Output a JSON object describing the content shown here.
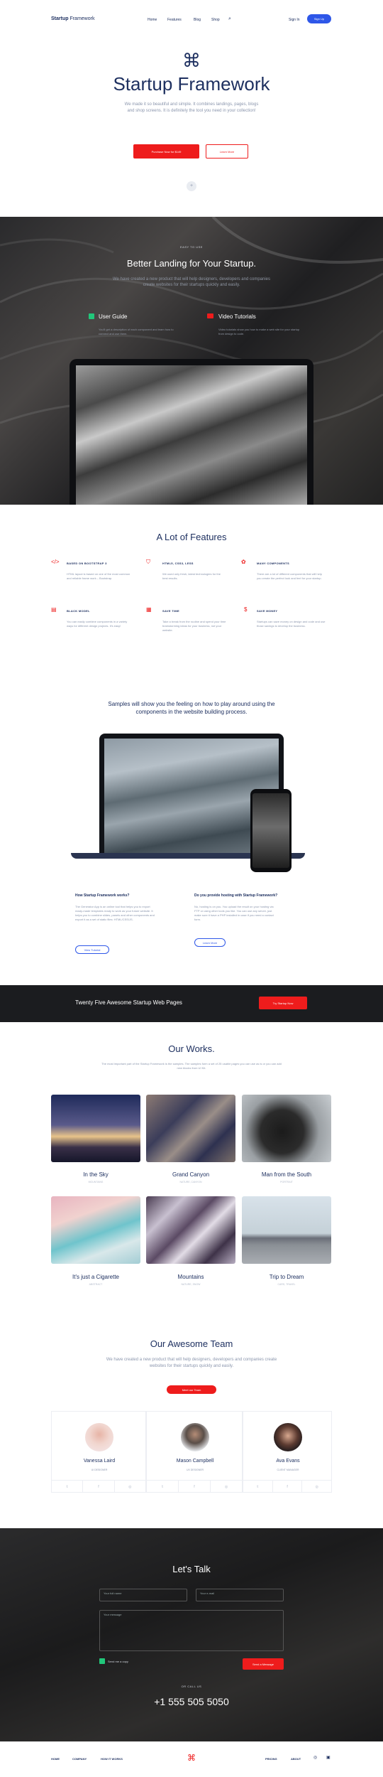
{
  "nav": {
    "logo_bold": "Startup",
    "logo_light": "Framework",
    "links": [
      "Home",
      "Features",
      "Blog",
      "Shop"
    ],
    "sign_in": "Sign In",
    "sign_up": "Sign Up"
  },
  "hero": {
    "title": "Startup Framework",
    "text": "We made it so beautiful and simple. It combines landings, pages, blogs and shop screens. It is definitely the tool you need in your collection!",
    "primary": "Purchase Now for $149",
    "secondary": "Learn More"
  },
  "dark_section": {
    "eyebrow": "EASY TO USE",
    "title": "Better Landing for Your Startup.",
    "text": "We have created a new product that will help designers, developers and companies create websites for their startups quickly and easily.",
    "items": [
      {
        "title": "User Guide",
        "text": "You'll get a description of each component and learn how to connect and use them."
      },
      {
        "title": "Video Tutorials",
        "text": "Video tutorials show you how to make a web site for your startup from design to code."
      }
    ]
  },
  "features": {
    "title": "A Lot of Features",
    "items": [
      {
        "title": "BASED ON BOOTSTRAP 3",
        "text": "HTML layout is based on one of the most common and reliable frame work – Bootstrap."
      },
      {
        "title": "HTML5, CSS3, LESS",
        "text": "We used only fresh, latest technologies for the best results."
      },
      {
        "title": "MANY COMPONENTS",
        "text": "There are a lot of different components that will help you create the perfect look and feel for your startup."
      },
      {
        "title": "BLACK MODEL",
        "text": "You can easily combine components in a variety ways for different design projects. It's easy!"
      },
      {
        "title": "SAVE TIME",
        "text": "Take a break from the routine and spend your time brainstorming ideas for your business, not your website."
      },
      {
        "title": "SAVE MONEY",
        "text": "Startups can save money on design and code and use those savings to develop the business."
      }
    ]
  },
  "samples": {
    "title": "Samples will show you the feeling on how to play around using the components in the website building process.",
    "faq": [
      {
        "q": "How Startup Framework works?",
        "a": "The Generator App is an online tool that helps you to export ready-made templates ready to work as your future website. It helps you to combine slides, panels and other components and export it as a set of static files: HTML/CSS/JS.",
        "btn": "View Tutorial"
      },
      {
        "q": "Do you provide hosting with Startup Framework?",
        "a": "No, hosting is on you. You upload the result on your hosting via FTP or using other tools you like. You can use any server, just make sure it have a PHP installed in case if you need a contact form.",
        "btn": "Learn More"
      }
    ]
  },
  "cta": {
    "text": "Twenty Five Awesome Startup Web Pages",
    "button": "Try Startup Now"
  },
  "works": {
    "title": "Our Works.",
    "text": "The most important part of the Startup Framework is the samples. The samples form a set of 25 usable pages you can use as is or you can add new blocks from UI Kit.",
    "items": [
      {
        "title": "In the Sky",
        "sub": "MOUNTAINS"
      },
      {
        "title": "Grand Canyon",
        "sub": "NATURE, CANYON"
      },
      {
        "title": "Man from the South",
        "sub": "PORTRAIT"
      },
      {
        "title": "It's just a Cigarette",
        "sub": "ABSTRACT"
      },
      {
        "title": "Mountains",
        "sub": "NATURE, SNOW"
      },
      {
        "title": "Trip to Dream",
        "sub": "CARS, TRAVEL"
      }
    ]
  },
  "team": {
    "title": "Our Awesome Team",
    "text": "We have created a new product that will help designers, developers and companies create websites for their startups quickly and easily.",
    "button": "Meet our Team",
    "members": [
      {
        "name": "Vanessa Laird",
        "role": "UI DESIGNER"
      },
      {
        "name": "Mason Campbell",
        "role": "UX DESIGNER"
      },
      {
        "name": "Ava Evans",
        "role": "CLIENT MANAGER"
      }
    ]
  },
  "contact": {
    "title": "Let's Talk",
    "name_placeholder": "Your full name",
    "email_placeholder": "Your e-mail",
    "message_placeholder": "Your message",
    "checkbox": "Send me a copy",
    "submit": "Send a Message",
    "call_label": "OR CALL US",
    "phone": "+1 555 505 5050"
  },
  "footer": {
    "left": [
      "HOME",
      "COMPANY",
      "HOW IT WORKS"
    ],
    "right": [
      "PRICING",
      "ABOUT"
    ]
  },
  "colors": {
    "accent": "#ee1c1c",
    "navy": "#1e3060",
    "blue": "#2e57e8"
  }
}
